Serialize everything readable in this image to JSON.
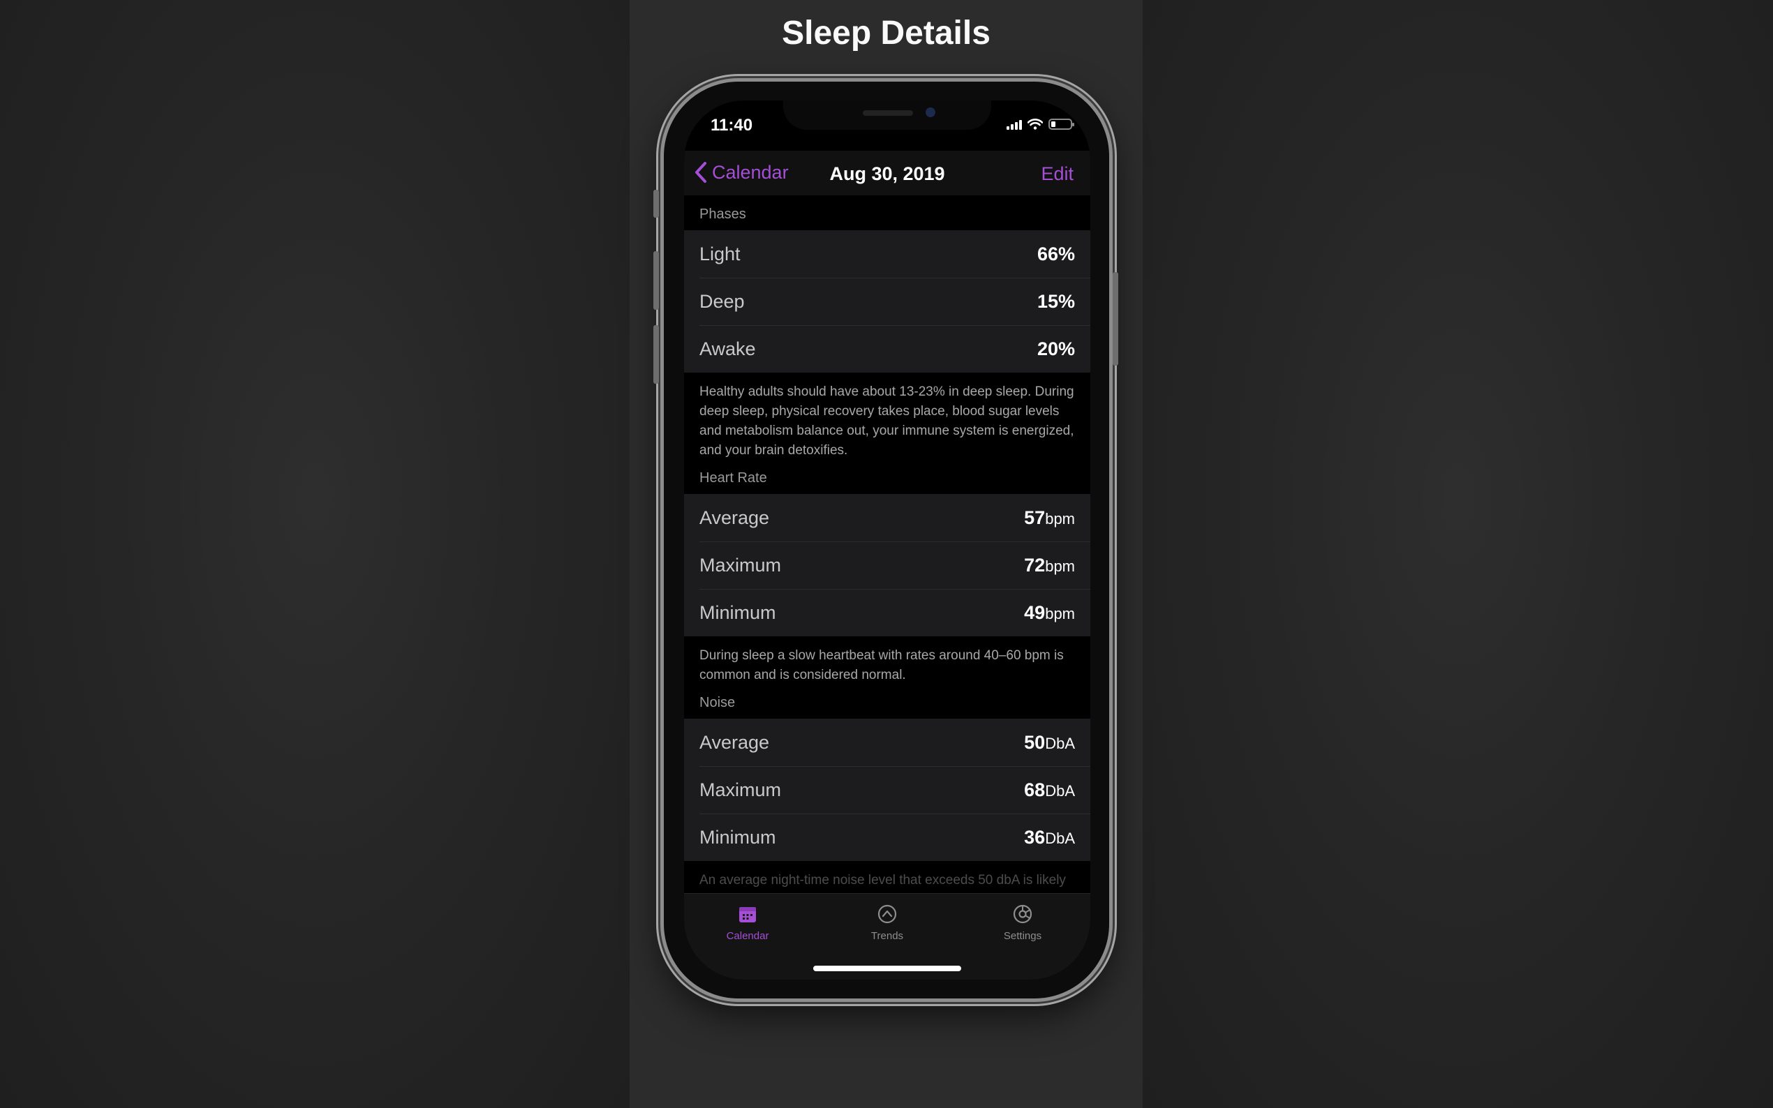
{
  "page_title": "Sleep Details",
  "status_bar": {
    "time": "11:40"
  },
  "nav": {
    "back_label": "Calendar",
    "title": "Aug 30, 2019",
    "edit_label": "Edit"
  },
  "phases": {
    "header": "Phases",
    "rows": [
      {
        "label": "Light",
        "value": "66%"
      },
      {
        "label": "Deep",
        "value": "15%"
      },
      {
        "label": "Awake",
        "value": "20%"
      }
    ],
    "footnote": "Healthy adults should have about 13-23% in deep sleep. During deep sleep, physical recovery takes place, blood sugar levels and metabolism balance out, your immune system is energized, and your brain detoxifies."
  },
  "heart_rate": {
    "header": "Heart Rate",
    "unit": "bpm",
    "rows": [
      {
        "label": "Average",
        "value": "57"
      },
      {
        "label": "Maximum",
        "value": "72"
      },
      {
        "label": "Minimum",
        "value": "49"
      }
    ],
    "footnote": "During sleep a slow heartbeat with rates around 40–60 bpm is common and is considered normal."
  },
  "noise": {
    "header": "Noise",
    "unit": "DbA",
    "rows": [
      {
        "label": "Average",
        "value": "50"
      },
      {
        "label": "Maximum",
        "value": "68"
      },
      {
        "label": "Minimum",
        "value": "36"
      }
    ],
    "footnote": "An average night-time noise level that exceeds 50 dbA is likely"
  },
  "tabbar": {
    "tabs": [
      {
        "label": "Calendar",
        "icon": "calendar-icon",
        "active": true
      },
      {
        "label": "Trends",
        "icon": "trends-icon",
        "active": false
      },
      {
        "label": "Settings",
        "icon": "settings-icon",
        "active": false
      }
    ]
  },
  "colors": {
    "accent": "#a54fd6",
    "background": "#000000",
    "group": "#1c1c1e"
  }
}
